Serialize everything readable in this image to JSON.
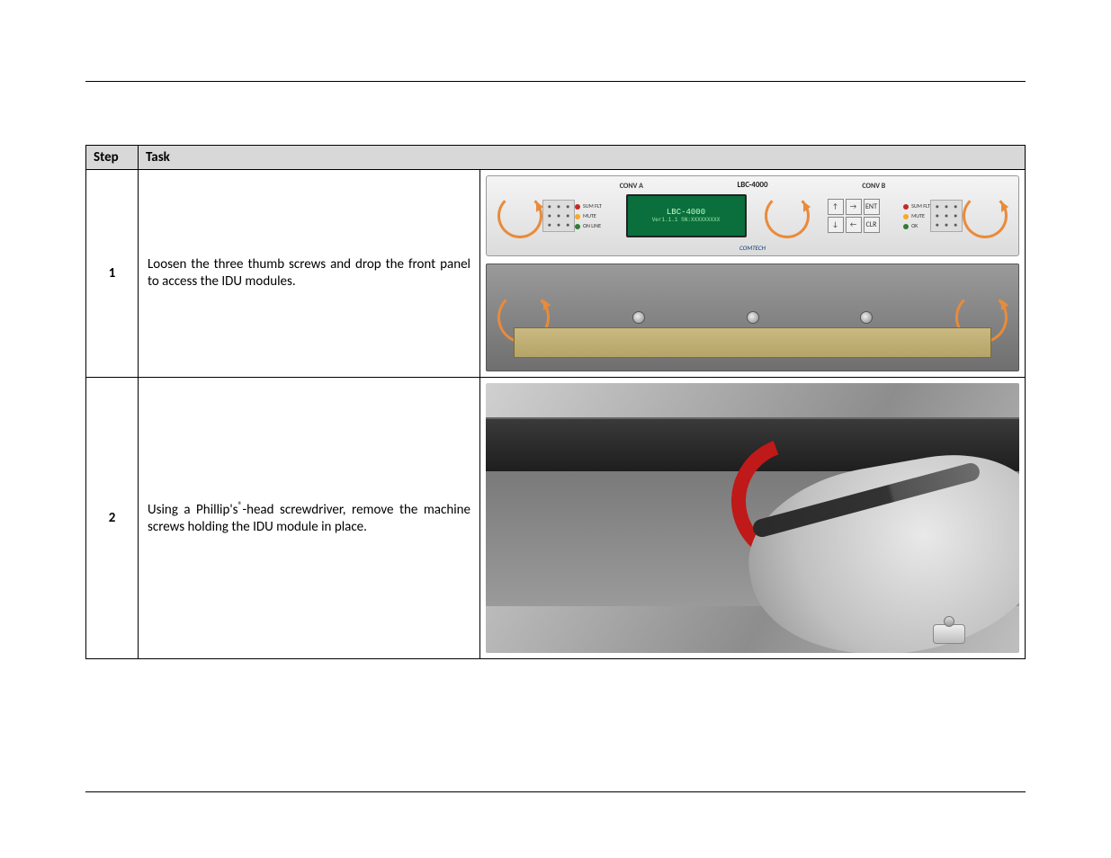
{
  "headers": {
    "step": "Step",
    "task": "Task"
  },
  "rows": [
    {
      "num": "1",
      "text": "Loosen the three thumb screws and drop the front panel to access the IDU modules."
    },
    {
      "num": "2",
      "text_pre": "Using a Phillip's",
      "text_sup": "®",
      "text_post": "-head screwdriver, remove the machine screws holding the IDU module in place."
    }
  ],
  "device": {
    "brand": "LBC-4000",
    "sub_brand": "COMTECH",
    "conv_a": "CONV A",
    "conv_b": "CONV B",
    "lcd_line1": "LBC-4000",
    "lcd_line2": "Ver1.1.1   SN:XXXXXXXXX",
    "leds": {
      "sum_flt": "SUM FLT",
      "mute": "MUTE",
      "online": "ON LINE",
      "ok": "OK"
    },
    "keys": {
      "up": "↑",
      "right": "→",
      "ent": "ENT",
      "down": "↓",
      "left": "←",
      "clr": "CLR"
    }
  }
}
